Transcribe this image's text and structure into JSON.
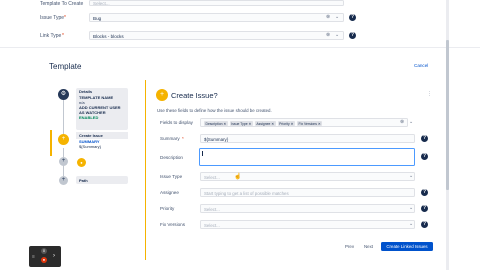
{
  "top_form": {
    "template_label": "Template To Create",
    "template_placeholder": "Select...",
    "issue_type_label": "Issue Type",
    "issue_type_value": "Bug",
    "link_type_label": "Link Type",
    "link_type_value": "Blocks - blocks"
  },
  "page_title": "Template",
  "cancel_label": "Cancel",
  "tree": {
    "details_title": "Details",
    "details_name_heading": "TEMPLATE NAME",
    "details_name_value": "n/a",
    "details_watcher_heading": "ADD CURRENT USER AS WATCHER",
    "details_watcher_value": "ENABLED",
    "create_issue_title": "Create Issue",
    "summary_heading": "SUMMARY",
    "summary_value": "${Summary}",
    "path_title": "Path"
  },
  "panel": {
    "title": "Create Issue?",
    "description": "Use these fields to define how the issue should be created.",
    "fields_to_display_label": "Fields to display",
    "chips": [
      "Description",
      "Issue Type",
      "Assignee",
      "Priority",
      "Fix Versions"
    ],
    "summary_label": "Summary",
    "summary_value": "${Summary}",
    "description_label": "Description",
    "issue_type_label": "Issue Type",
    "issue_type_placeholder": "Select...",
    "assignee_label": "Assignee",
    "assignee_placeholder": "Start typing to get a list of possible matches",
    "priority_label": "Priority",
    "priority_placeholder": "Select...",
    "fix_versions_label": "Fix Versions",
    "fix_versions_placeholder": "Select...",
    "prev_label": "Prev",
    "next_label": "Next",
    "create_label": "Create Linked Issues"
  },
  "zoom_widget": {
    "top_value": "0"
  }
}
